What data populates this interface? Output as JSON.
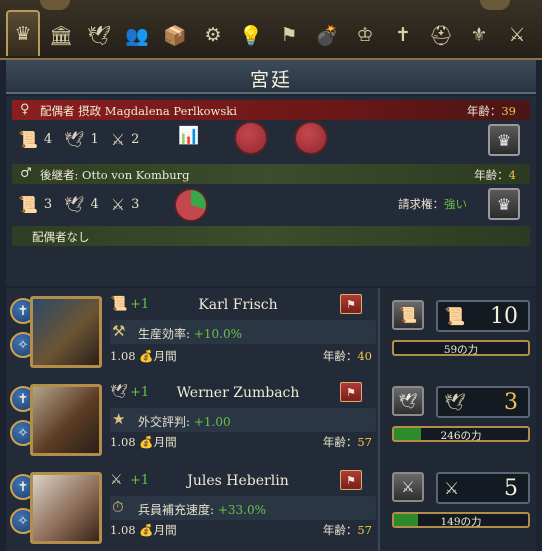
{
  "tabs": [
    {
      "icon": "crown-icon",
      "glyph": "♛"
    },
    {
      "icon": "court-building-icon",
      "glyph": "🏛"
    },
    {
      "icon": "dove-icon",
      "glyph": "🕊"
    },
    {
      "icon": "people-icon",
      "glyph": "👥"
    },
    {
      "icon": "crate-icon",
      "glyph": "📦"
    },
    {
      "icon": "gears-icon",
      "glyph": "⚙"
    },
    {
      "icon": "lightbulb-icon",
      "glyph": "💡"
    },
    {
      "icon": "flag-icon",
      "glyph": "⚑"
    },
    {
      "icon": "cannon-icon",
      "glyph": "💣"
    },
    {
      "icon": "crown-banner-icon",
      "glyph": "♔"
    },
    {
      "icon": "cross-icon",
      "glyph": "✝"
    },
    {
      "icon": "helmet-icon",
      "glyph": "⛑"
    },
    {
      "icon": "heraldry-icon",
      "glyph": "⚜"
    },
    {
      "icon": "crossed-swords-icon",
      "glyph": "⚔"
    }
  ],
  "title": "宮廷",
  "consort": {
    "label": "配偶者 摂政 Magdalena Perlkowski",
    "age_label": "年齢：",
    "age": "39",
    "adm": "4",
    "dip": "1",
    "mil": "2"
  },
  "heir": {
    "label": "後継者: Otto von Komburg",
    "age_label": "年齢：",
    "age": "4",
    "adm": "3",
    "dip": "4",
    "mil": "3",
    "claim_label": "請求権：",
    "claim": "強い"
  },
  "no_spouse": "配偶者なし",
  "advisors": [
    {
      "skill": "+1",
      "name": "Karl Frisch",
      "effect_label": "生産効率: ",
      "effect_value": "+10.0%",
      "cost": "1.08",
      "cost_unit": "月間",
      "age_label": "年齢：",
      "age": "40"
    },
    {
      "skill": "+1",
      "name": "Werner Zumbach",
      "effect_label": "外交評判: ",
      "effect_value": "+1.00",
      "cost": "1.08",
      "cost_unit": "月間",
      "age_label": "年齢：",
      "age": "57"
    },
    {
      "skill": "+1",
      "name": "Jules Heberlin",
      "effect_label": "兵員補充速度: ",
      "effect_value": "+33.0%",
      "cost": "1.08",
      "cost_unit": "月間",
      "age_label": "年齢：",
      "age": "57"
    }
  ],
  "power": [
    {
      "value": "10",
      "label": "59の力",
      "fill": 0.0
    },
    {
      "value": "3",
      "label": "246の力",
      "fill": 0.2
    },
    {
      "value": "5",
      "label": "149の力",
      "fill": 0.18
    }
  ],
  "colors": {
    "accent_gold": "#f2c64a",
    "positive": "#68c244",
    "consort_bar": "#8a1e1e",
    "heir_bar": "#3b4d2c"
  }
}
